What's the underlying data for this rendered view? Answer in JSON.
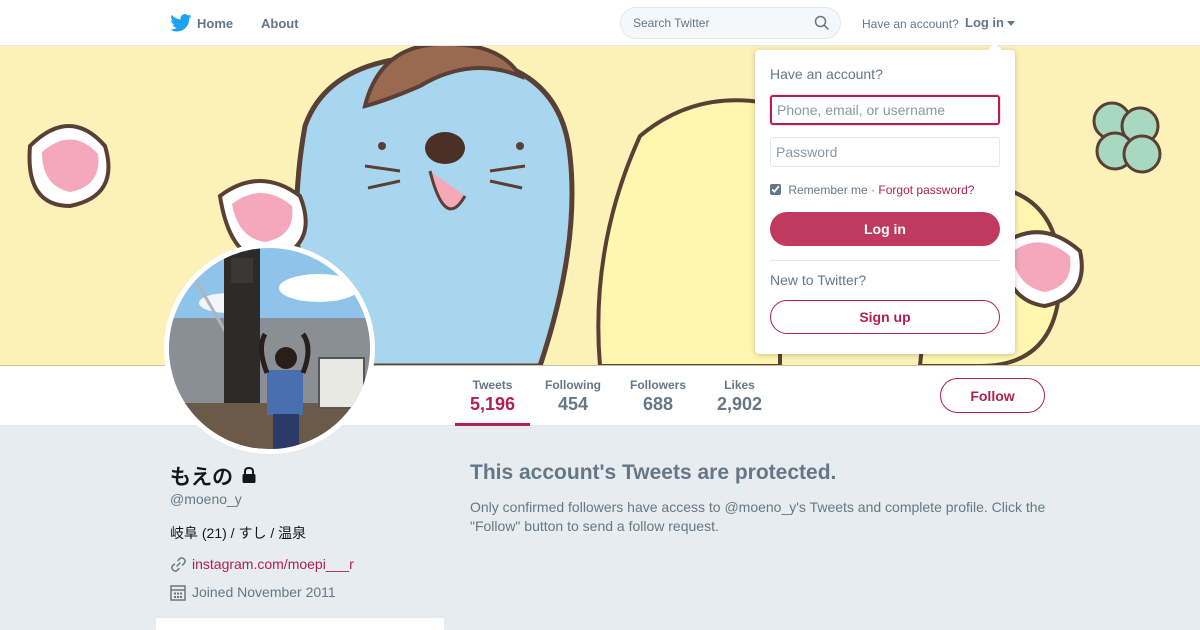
{
  "colors": {
    "accent": "#b0214f",
    "login_button": "#c0395f",
    "muted": "#657786",
    "page_bg": "#e6ecf0"
  },
  "topnav": {
    "logo_icon": "twitter-bird-icon",
    "home_label": "Home",
    "about_label": "About",
    "search_placeholder": "Search Twitter",
    "have_account": "Have an account?",
    "login_label": "Log in"
  },
  "profile": {
    "name": "もえの",
    "handle": "@moeno_y",
    "bio": "岐阜 (21) / すし / 温泉",
    "link": "instagram.com/moepi___r",
    "joined": "Joined November 2011"
  },
  "stats": [
    {
      "label": "Tweets",
      "value": "5,196"
    },
    {
      "label": "Following",
      "value": "454"
    },
    {
      "label": "Followers",
      "value": "688"
    },
    {
      "label": "Likes",
      "value": "2,902"
    }
  ],
  "follow_label": "Follow",
  "protected": {
    "title": "This account's Tweets are protected.",
    "body": "Only confirmed followers have access to @moeno_y's Tweets and complete profile. Click the \"Follow\" button to send a follow request."
  },
  "login_dropdown": {
    "title": "Have an account?",
    "username_placeholder": "Phone, email, or username",
    "password_placeholder": "Password",
    "remember": "Remember me",
    "separator": "·",
    "forgot": "Forgot password?",
    "login_button": "Log in",
    "new_to": "New to Twitter?",
    "signup_button": "Sign up"
  }
}
